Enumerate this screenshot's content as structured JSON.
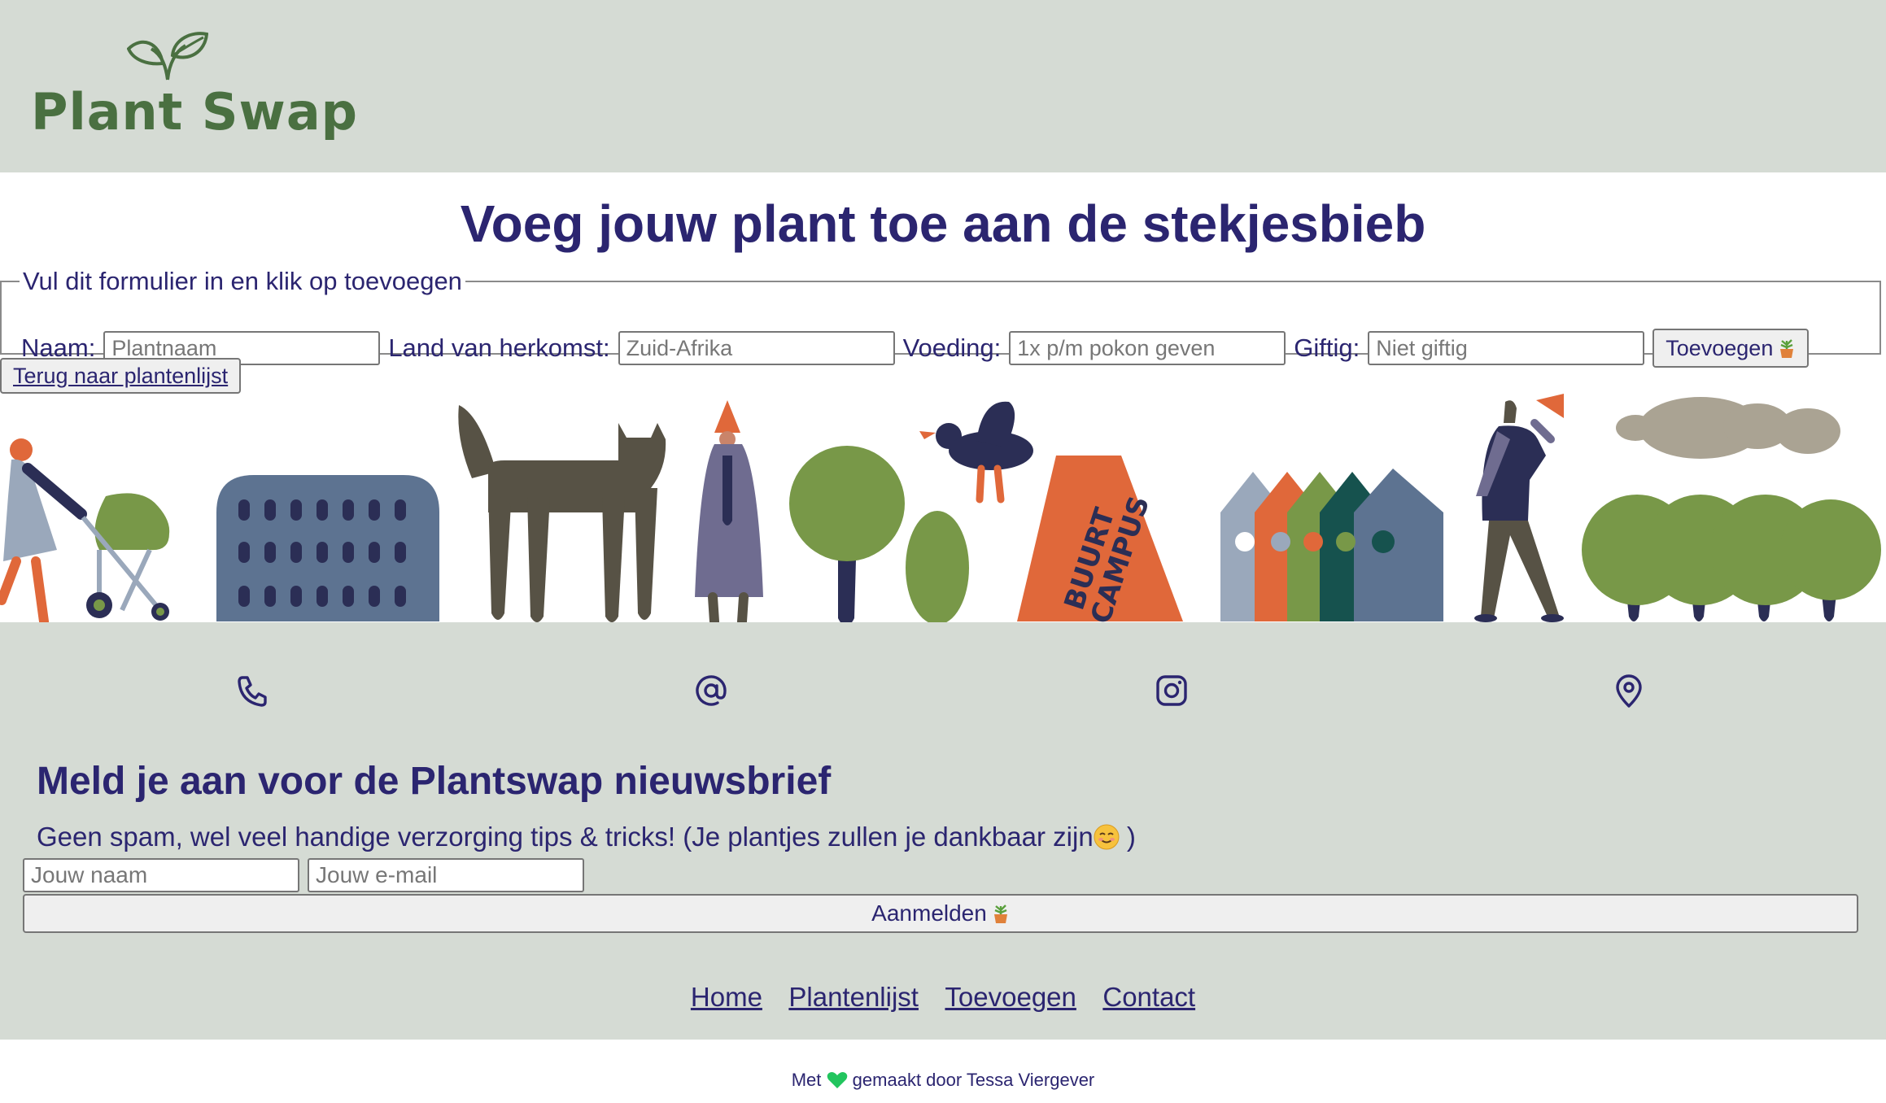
{
  "brand": {
    "name": "Plant Swap",
    "accent": "#4a7041"
  },
  "colors": {
    "header_bg": "#d5dbd4",
    "text": "#2b2570"
  },
  "page": {
    "title": "Voeg jouw plant toe aan de stekjesbieb"
  },
  "form": {
    "legend": "Vul dit formulier in en klik op toevoegen",
    "fields": [
      {
        "label": "Naam:",
        "placeholder": "Plantnaam",
        "value": ""
      },
      {
        "label": "Land van herkomst:",
        "placeholder": "Zuid-Afrika",
        "value": ""
      },
      {
        "label": "Voeding:",
        "placeholder": "1x p/m pokon geven",
        "value": ""
      },
      {
        "label": "Giftig:",
        "placeholder": "Niet giftig",
        "value": ""
      }
    ],
    "submit_label": "Toevoegen",
    "submit_icon": "potted-plant-icon"
  },
  "back_button": "Terug naar plantenlijst",
  "illustration": {
    "sign_text_line1": "BUURT",
    "sign_text_line2": "CAMPUS"
  },
  "contact_icons": [
    "phone-icon",
    "at-icon",
    "instagram-icon",
    "location-pin-icon"
  ],
  "newsletter": {
    "title": "Meld je aan voor de Plantswap nieuwsbrief",
    "subtitle_before": "Geen spam, wel veel handige verzorging tips & tricks! (Je plantjes zullen je dankbaar zijn",
    "subtitle_after": " )",
    "name_placeholder": "Jouw naam",
    "email_placeholder": "Jouw e-mail",
    "submit_label": "Aanmelden"
  },
  "nav": {
    "items": [
      "Home",
      "Plantenlijst",
      "Toevoegen",
      "Contact"
    ]
  },
  "credit": {
    "before": "Met",
    "after": "gemaakt door Tessa Viergever",
    "heart_color": "#22c55e"
  }
}
